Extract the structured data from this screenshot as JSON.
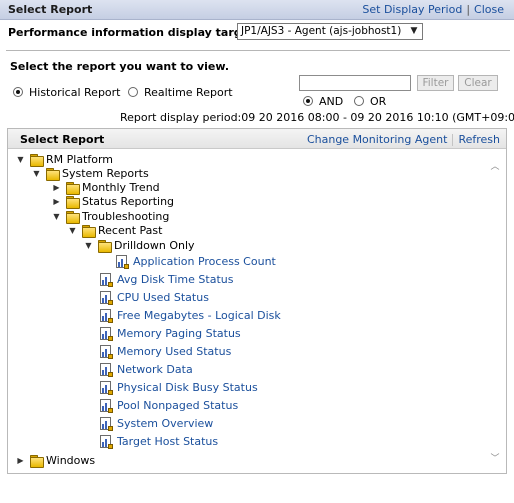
{
  "window": {
    "title": "Select Report",
    "links": [
      "Set Display Period",
      "Close"
    ]
  },
  "target": {
    "label": "Performance information display target:",
    "selected": "JP1/AJS3 - Agent (ajs-jobhost1)"
  },
  "report_select": {
    "prompt": "Select the report you want to view.",
    "filter_placeholder": "",
    "filter_button": "Filter",
    "clear_button": "Clear",
    "mode_options": [
      {
        "label": "Historical Report",
        "selected": true
      },
      {
        "label": "Realtime Report",
        "selected": false
      }
    ],
    "logic_options": [
      {
        "label": "AND",
        "selected": true
      },
      {
        "label": "OR",
        "selected": false
      }
    ],
    "period_text": "Report display period:09 20 2016 08:00 - 09 20 2016 10:10 (GMT+09:00)"
  },
  "panel": {
    "title": "Select Report",
    "change_agent": "Change Monitoring Agent",
    "refresh": "Refresh"
  },
  "tree": {
    "rm_platform": "RM Platform",
    "system_reports": "System Reports",
    "monthly_trend": "Monthly Trend",
    "status_reporting": "Status Reporting",
    "troubleshooting": "Troubleshooting",
    "recent_past": "Recent Past",
    "drilldown_only": "Drilldown Only",
    "application_process_count": "Application Process Count",
    "reports": [
      "Avg Disk Time Status",
      "CPU Used Status",
      "Free Megabytes - Logical Disk",
      "Memory Paging Status",
      "Memory Used Status",
      "Network Data",
      "Physical Disk Busy Status",
      "Pool Nonpaged Status",
      "System Overview",
      "Target Host Status"
    ],
    "windows": "Windows"
  },
  "icons": {
    "folder": "folder-icon",
    "report": "report-icon",
    "expanded": "triangle-down",
    "collapsed": "triangle-right"
  },
  "colors": {
    "titlebar": "#c5cee3",
    "link": "#1a4f9c",
    "folder": "#e8b800"
  }
}
